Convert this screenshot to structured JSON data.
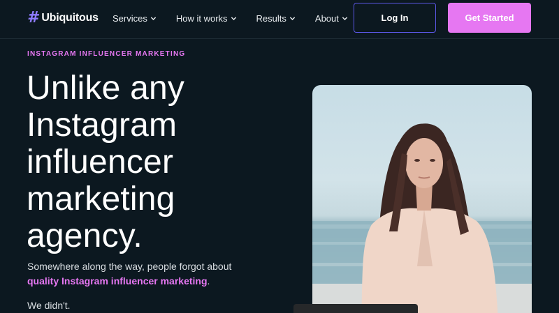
{
  "brand": {
    "logo_symbol": "#",
    "name": "Ubiquitous"
  },
  "nav": {
    "items": [
      {
        "label": "Services"
      },
      {
        "label": "How it works"
      },
      {
        "label": "Results"
      },
      {
        "label": "About"
      }
    ],
    "login_label": "Log In",
    "cta_label": "Get Started"
  },
  "hero": {
    "eyebrow": "INSTAGRAM INFLUENCER MARKETING",
    "headline": "Unlike any Instagram influencer marketing agency.",
    "sub_text": "Somewhere along the way, people forgot about",
    "sub_highlight": "quality Instagram influencer marketing",
    "sub_end": ".",
    "closing": "We didn't."
  },
  "colors": {
    "background": "#0c1820",
    "accent_pink": "#e677f2",
    "accent_violet": "#5b57e6"
  }
}
